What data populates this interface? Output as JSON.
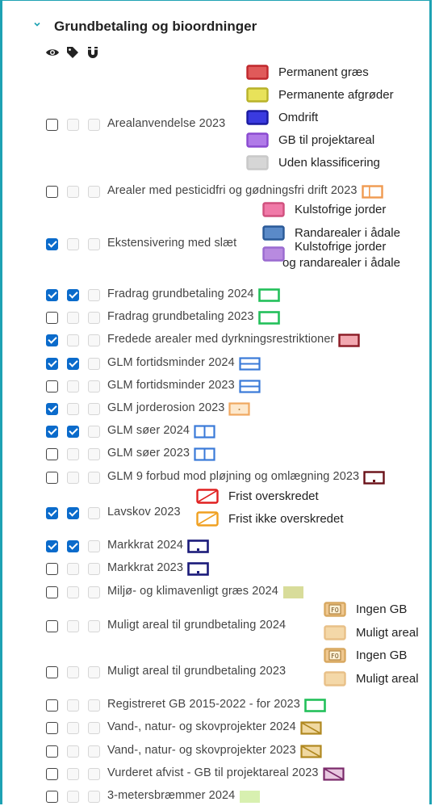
{
  "header": {
    "title": "Grundbetaling og bioordninger"
  },
  "header_icons": [
    "eye-icon",
    "tag-icon",
    "magnet-icon"
  ],
  "layers": [
    {
      "name": "Arealanvendelse 2023",
      "visible": false,
      "labels": false,
      "snap": false,
      "legend": [
        {
          "label": "Permanent græs",
          "fill": "#e05a5a",
          "stroke": "#c0282d"
        },
        {
          "label": "Permanente afgrøder",
          "fill": "#e8e25a",
          "stroke": "#b8b22a"
        },
        {
          "label": "Omdrift",
          "fill": "#3a3ae0",
          "stroke": "#1a1aa0"
        },
        {
          "label": "GB til projektareal",
          "fill": "#b07ae8",
          "stroke": "#8a4ad0"
        },
        {
          "label": "Uden klassificering",
          "fill": "#d6d6d6",
          "stroke": "#c8c8c8"
        }
      ]
    },
    {
      "name": "Arealer med pesticidfri og gødningsfri drift 2023",
      "visible": false,
      "labels": false,
      "snap": false,
      "icon": "orange-outline"
    },
    {
      "name": "Ekstensivering med slæt",
      "visible": true,
      "labels": false,
      "snap": false,
      "legend": [
        {
          "label": "Kulstofrige jorder",
          "fill": "#f07aa8",
          "stroke": "#d0507e"
        },
        {
          "label": "Randarealer i ådale",
          "fill": "#5a8ac8",
          "stroke": "#2a5a98"
        },
        {
          "label": "Kulstofrige jorder og randarealer i ådale",
          "line1": "Kulstofrige jorder",
          "line2": "og randarealer i ådale",
          "fill": "#b88ae0",
          "stroke": "#9a6ad0"
        }
      ]
    },
    {
      "name": "Fradrag grundbetaling 2024",
      "visible": true,
      "labels": true,
      "snap": false,
      "icon": "green-outline"
    },
    {
      "name": "Fradrag grundbetaling 2023",
      "visible": false,
      "labels": false,
      "snap": false,
      "icon": "green-outline"
    },
    {
      "name": "Fredede arealer med dyrkningsrestriktioner",
      "visible": true,
      "labels": false,
      "snap": false,
      "icon": "maroon-pink"
    },
    {
      "name": "GLM fortidsminder 2024",
      "visible": true,
      "labels": true,
      "snap": false,
      "icon": "blue-lines"
    },
    {
      "name": "GLM fortidsminder 2023",
      "visible": false,
      "labels": false,
      "snap": false,
      "icon": "blue-lines"
    },
    {
      "name": "GLM jorderosion 2023",
      "visible": true,
      "labels": false,
      "snap": false,
      "icon": "orange-dot"
    },
    {
      "name": "GLM søer 2024",
      "visible": true,
      "labels": true,
      "snap": false,
      "icon": "blue-split"
    },
    {
      "name": "GLM søer 2023",
      "visible": false,
      "labels": false,
      "snap": false,
      "icon": "blue-split"
    },
    {
      "name": "GLM 9 forbud mod pløjning og omlægning 2023",
      "visible": false,
      "labels": false,
      "snap": false,
      "icon": "maroon-outline"
    },
    {
      "name": "Lavskov 2023",
      "visible": true,
      "labels": true,
      "snap": false,
      "legend": [
        {
          "label": "Frist overskredet",
          "fill": "#ffffff",
          "stroke": "#e02020",
          "diag": true
        },
        {
          "label": "Frist ikke overskredet",
          "fill": "#ffffff",
          "stroke": "#f0a020",
          "diag": true
        }
      ]
    },
    {
      "name": "Markkrat 2024",
      "visible": true,
      "labels": true,
      "snap": false,
      "icon": "navy-outline"
    },
    {
      "name": "Markkrat 2023",
      "visible": false,
      "labels": false,
      "snap": false,
      "icon": "navy-outline"
    },
    {
      "name": "Miljø- og klimavenligt græs 2024",
      "visible": false,
      "labels": false,
      "snap": false,
      "icon": "olive-fill"
    },
    {
      "name": "Muligt areal til grundbetaling 2024",
      "visible": false,
      "labels": false,
      "snap": false,
      "legend": [
        {
          "label": "Ingen GB",
          "fill": "#f0c890",
          "stroke": "#d8a860",
          "pattern": true
        },
        {
          "label": "Muligt areal",
          "fill": "#f4d8a8",
          "stroke": "#e8c088"
        }
      ]
    },
    {
      "name": "Muligt areal til grundbetaling 2023",
      "visible": false,
      "labels": false,
      "snap": false,
      "legend": [
        {
          "label": "Ingen GB",
          "fill": "#f0c890",
          "stroke": "#d8a860",
          "pattern": true
        },
        {
          "label": "Muligt areal",
          "fill": "#f4d8a8",
          "stroke": "#e8c088"
        }
      ]
    },
    {
      "name": "Registreret GB 2015-2022 - for 2023",
      "visible": false,
      "labels": false,
      "snap": false,
      "icon": "green-outline"
    },
    {
      "name": "Vand-, natur- og skovprojekter 2024",
      "visible": false,
      "labels": false,
      "snap": false,
      "icon": "gold-diag"
    },
    {
      "name": "Vand-, natur- og skovprojekter 2023",
      "visible": false,
      "labels": false,
      "snap": false,
      "icon": "gold-diag"
    },
    {
      "name": "Vurderet afvist - GB til projektareal 2023",
      "visible": false,
      "labels": false,
      "snap": false,
      "icon": "purple-diag"
    },
    {
      "name": "3-metersbræmmer 2024",
      "visible": false,
      "labels": false,
      "snap": false,
      "icon": "lightgreen-fill"
    }
  ]
}
